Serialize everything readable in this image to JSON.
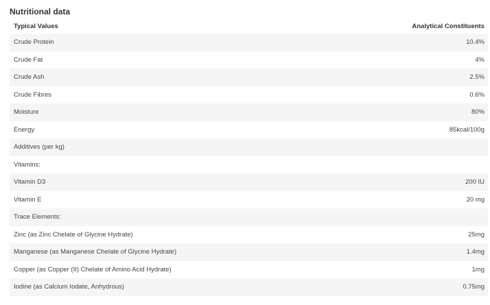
{
  "title": "Nutritional data",
  "header": {
    "left": "Typical Values",
    "right": "Analytical Constituents"
  },
  "rows": [
    {
      "label": "Crude Protein",
      "value": "10.4%"
    },
    {
      "label": "Crude Fat",
      "value": "4%"
    },
    {
      "label": "Crude Ash",
      "value": "2.5%"
    },
    {
      "label": "Crude Fibres",
      "value": "0.6%"
    },
    {
      "label": "Moisture",
      "value": "80%"
    },
    {
      "label": "Energy",
      "value": "85kcal/100g"
    },
    {
      "label": "Additives (per kg)",
      "value": ""
    },
    {
      "label": "Vitamins:",
      "value": ""
    },
    {
      "label": "Vitamin D3",
      "value": "200 IU"
    },
    {
      "label": "Vitamin E",
      "value": "20 mg"
    },
    {
      "label": "Trace Elements:",
      "value": ""
    },
    {
      "label": "Zinc (as Zinc Chelate of Glycine Hydrate)",
      "value": "25mg"
    },
    {
      "label": "Manganese (as Manganese Chelate of Glycine Hydrate)",
      "value": "1.4mg"
    },
    {
      "label": "Copper (as Copper (II) Chelate of Amino Acid Hydrate)",
      "value": "1mg"
    },
    {
      "label": "Iodine (as Calcium Iodate, Anhydrous)",
      "value": "0.75mg"
    }
  ],
  "colors": {
    "shaded_row": "#f5f5f5",
    "text": "#444444"
  }
}
